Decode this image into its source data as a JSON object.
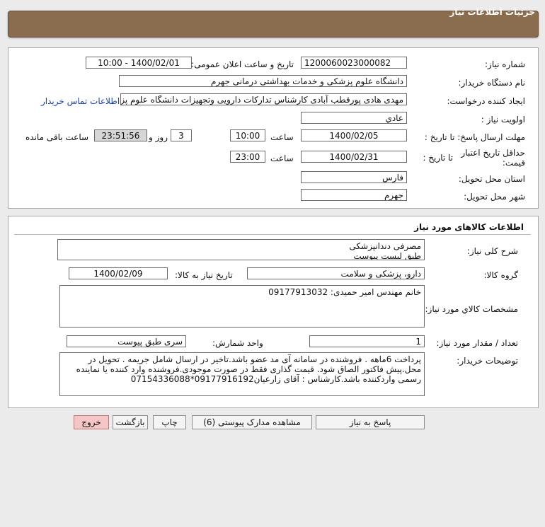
{
  "header": {
    "title": "جزئیات اطلاعات نیاز"
  },
  "info": {
    "need_number_label": "شماره نیاز:",
    "need_number": "1200060023000082",
    "announce_label": "تاریخ و ساعت اعلان عمومی:",
    "announce_value": "1400/02/01 - 10:00",
    "buyer_label": "نام دستگاه خریدار:",
    "buyer_value": "دانشگاه علوم پزشکی و خدمات بهداشتی درمانی جهرم",
    "creator_label": "ایجاد کننده درخواست:",
    "creator_value": "مهدی هادی پورقطب آبادی کارشناس تدارکات دارویی وتجهیزات دانشگاه علوم پزشکی",
    "contact_link": "اطلاعات تماس خریدار",
    "priority_label": "اولویت نیاز :",
    "priority_value": "عادي",
    "deadline_label": "مهلت ارسال پاسخ: تا تاریخ :",
    "deadline_date": "1400/02/05",
    "time_label": "ساعت",
    "deadline_time": "10:00",
    "days_value": "3",
    "days_label": "روز و",
    "remaining_time": "23:51:56",
    "remaining_label": "ساعت باقی مانده",
    "validity_label": "حداقل تاریخ اعتبار قیمت:",
    "validity_sub_label": "تا تاریخ :",
    "validity_date": "1400/02/31",
    "validity_time_label": "ساعت",
    "validity_time": "23:00",
    "province_label": "استان محل تحویل:",
    "province_value": "فارس",
    "city_label": "شهر محل تحویل:",
    "city_value": "جهرم"
  },
  "goods": {
    "section_title": "اطلاعات کالاهای مورد نیاز",
    "desc_label": "شرح کلی نیاز:",
    "desc_line1": "مصرفی دندانپزشکی",
    "desc_line2": "طبق لیست پیوست",
    "group_label": "گروه کالا:",
    "group_value": "دارو، پزشکی و سلامت",
    "need_date_label": "تاریخ نیاز به کالا:",
    "need_date_value": "1400/02/09",
    "spec_label": "مشخصات کالاي مورد نیاز:",
    "spec_value": "خانم مهندس امیر حمیدی: 09177913032",
    "qty_label": "تعداد / مقدار مورد نیاز:",
    "qty_value": "1",
    "unit_label": "واحد شمارش:",
    "unit_value": "سری طبق پیوست",
    "buyer_notes_label": "توضیحات خریدار:",
    "buyer_notes": "پرداخت 6ماهه . فروشنده در سامانه آی مد عضو باشد.تاخیر در ارسال شامل جریمه . تحویل در محل.پیش فاکتور الصاق شود. قیمت گذاری فقط در صورت موجودی.فروشنده وارد کننده یا نماینده رسمی واردکننده باشد.کارشناس : آقای زارعیان09177916192*07154336088"
  },
  "actions": {
    "reply": "پاسخ به نیاز",
    "view_docs": "مشاهده مدارک پیوستی (6)",
    "print": "چاپ",
    "back": "بازگشت",
    "exit": "خروج"
  }
}
